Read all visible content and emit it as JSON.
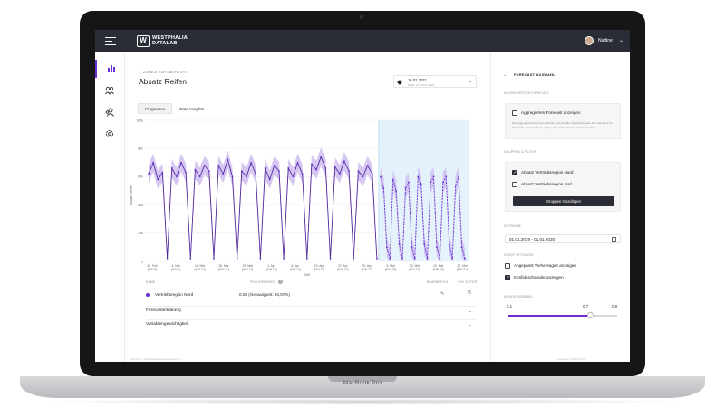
{
  "device": {
    "brand_label": "MacBook Pro"
  },
  "header": {
    "logo_line1": "WESTPHALIA",
    "logo_line2": "DATALAB",
    "username": "Nadine"
  },
  "nav": {
    "items": [
      {
        "name": "chart",
        "icon": "bar-chart-icon"
      },
      {
        "name": "users",
        "icon": "users-icon"
      },
      {
        "name": "people",
        "icon": "people-icon"
      },
      {
        "name": "settings",
        "icon": "settings-icon"
      }
    ]
  },
  "main": {
    "back_link": "← ZURÜCK ZUR ÜBERSICHT",
    "title": "Absatz Reifen",
    "date_main": "16.01.2021",
    "date_sub": "Daten von 16.01.2021",
    "tabs": [
      "Prognosen",
      "Data Insights"
    ],
    "table": {
      "col_name": "NAME",
      "col_error": "FEHLERMASSE",
      "col_edit": "BEARBEITEN",
      "col_export": "CSV EXPORT",
      "row_name": "Vertriebsregion Nord",
      "row_error": "0,06 (Genauigkeit: 94,07%)"
    },
    "accordions": [
      "Forecasterklärung",
      "Variablengewichtigkeit"
    ]
  },
  "chart_data": {
    "type": "line",
    "title": "",
    "xlabel": "Zeit",
    "ylabel": "Absatz Reifen",
    "yticks": [
      "0",
      "20k",
      "40k",
      "60k",
      "80k",
      "100k"
    ],
    "ylim": [
      0,
      100000
    ],
    "x_ticks": [
      [
        "25. Feb",
        "(KW 8)"
      ],
      [
        "4. Mär",
        "(KW 9)"
      ],
      [
        "11. Mär",
        "(KW 10)"
      ],
      [
        "18. Mär",
        "(KW 11)"
      ],
      [
        "25. Mär",
        "(KW 12)"
      ],
      [
        "1. Apr",
        "(KW 13)"
      ],
      [
        "8. Apr",
        "(KW 14)"
      ],
      [
        "15. Apr",
        "(KW 15)"
      ],
      [
        "22. Apr",
        "(KW 16)"
      ],
      [
        "29. Apr",
        "(KW 17)"
      ],
      [
        "6. Mai",
        "(KW 18)"
      ],
      [
        "13. Mai",
        "(KW 19)"
      ],
      [
        "20. Mai",
        "(KW 20)"
      ],
      [
        "27. Mai",
        "(KW 21)"
      ]
    ],
    "forecast_start_week": 10,
    "grid": true,
    "series": [
      {
        "style": "historical",
        "values": [
          62000,
          70000,
          58000,
          63000,
          2000,
          66000,
          60000,
          70000,
          63000,
          2000,
          65000,
          60000,
          68000,
          64000,
          2000,
          68000,
          62000,
          72000,
          60000,
          2000,
          64000,
          60000,
          70000,
          62000,
          2000,
          66000,
          58000,
          68000,
          64000,
          2000,
          66000,
          60000,
          70000,
          62000,
          2000,
          69000,
          65000,
          74000,
          66000,
          2000,
          67000,
          62000,
          71000,
          64000,
          2000,
          64000,
          60000,
          68000,
          62000,
          2000
        ]
      },
      {
        "style": "forecast",
        "values": [
          60000,
          52000,
          10000,
          2000,
          58000,
          50000,
          12000,
          2000,
          52000,
          56000,
          10000,
          2000,
          60000,
          55000,
          12000,
          2000,
          56000,
          60000,
          10000,
          2000,
          56000,
          60000,
          12000,
          2000,
          54000,
          60000,
          10000,
          2000
        ]
      }
    ]
  },
  "panel": {
    "title": "FORECAST AUSWAHL",
    "sec_aggregated": "AGGREGIERTER FORECAST",
    "aggregated_label": "Aggregierten Forecast anzeigen",
    "aggregated_note": "Der Aggregierte Forecast stellt die Summe aller Einzelforecasts dar und dient zur Übersicht. Um Details zu sehen, fügen Sie einzelne Forecasts hinzu.",
    "sec_groups": "GRUPPEN & FILTER",
    "group_north": "Absatz Vertriebsregion Nord",
    "group_south": "Absatz Vertriebsregion Süd",
    "add_groups_button": "Gruppen hinzufügen",
    "sec_period": "ZEITRAUM",
    "period_value": "01.01.2019 - 01.01.2020",
    "sec_chart_options": "CHART OPTIONEN",
    "opt_adjusted": "Angepasst Vorhersagen anzeigen",
    "opt_confidence": "Konfidenzbänder anzeigen",
    "sec_confidence": "KONFIDENZBAND",
    "slider_min": "0.1",
    "slider_value": "0.7",
    "slider_max": "0.9",
    "slider_level": 0.7,
    "checked": {
      "aggregated": false,
      "north": true,
      "south": false,
      "adjusted": false,
      "confidence": true
    }
  },
  "footer": {
    "left": "Copyright © 2020 Westphalia DataLab GmbH",
    "right": "Impressum     Datenschutz"
  },
  "colors": {
    "accent": "#6a2fd0",
    "dark": "#2b2d36",
    "band": "#c8b4ee",
    "forecast_bg": "#e4f2fb"
  }
}
